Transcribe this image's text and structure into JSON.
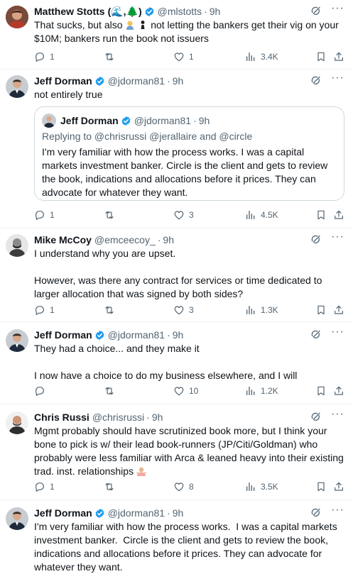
{
  "tweets": [
    {
      "name": "Matthew Stotts",
      "name_suffix": "(🌊,🌲)",
      "handle": "@mlstotts",
      "time": "9h",
      "text_pre": "That sucks, but also",
      "text_post": "not letting the bankers get their vig on your $10M; bankers run the book not issuers",
      "replies": "1",
      "retweets": "",
      "likes": "1",
      "views": "3.4K"
    },
    {
      "name": "Jeff Dorman",
      "handle": "@jdorman81",
      "time": "9h",
      "text": "not entirely true",
      "quote": {
        "name": "Jeff Dorman",
        "handle": "@jdorman81",
        "time": "9h",
        "replying": "Replying to @chrisrussi @jerallaire and @circle",
        "text": "I'm very familiar with how the process works.  I was a capital markets investment banker.  Circle is the client and gets to review the book, indications and allocations before it prices. They can advocate for whatever they want."
      },
      "replies": "1",
      "retweets": "",
      "likes": "3",
      "views": "4.5K"
    },
    {
      "name": "Mike McCoy",
      "handle": "@emceecoy_",
      "time": "9h",
      "text": "I understand why you are upset.\n\nHowever, was there any contract for services or time dedicated to larger allocation that was signed by both sides?",
      "replies": "1",
      "retweets": "",
      "likes": "3",
      "views": "1.3K"
    },
    {
      "name": "Jeff Dorman",
      "handle": "@jdorman81",
      "time": "9h",
      "text": "They had a choice... and they make it\n\nI now have a choice to do my business elsewhere, and I will",
      "replies": "",
      "retweets": "",
      "likes": "10",
      "views": "1.2K"
    },
    {
      "name": "Chris Russi",
      "handle": "@chrisrussi",
      "time": "9h",
      "text": "Mgmt probably should have scrutinized book more, but I think your bone to pick is w/ their lead book-runners (JP/Citi/Goldman) who probably were less familiar with Arca & leaned heavy into their existing trad. inst. relationships",
      "replies": "1",
      "retweets": "",
      "likes": "8",
      "views": "3.5K"
    },
    {
      "name": "Jeff Dorman",
      "handle": "@jdorman81",
      "time": "9h",
      "text": "I'm very familiar with how the process works.  I was a capital markets investment banker.  Circle is the client and gets to review the book, indications and allocations before it prices. They can advocate for whatever they want."
    }
  ],
  "colors": {
    "verified": "#1d9bf0",
    "secondary": "#536471",
    "divider": "#eff3f4"
  }
}
